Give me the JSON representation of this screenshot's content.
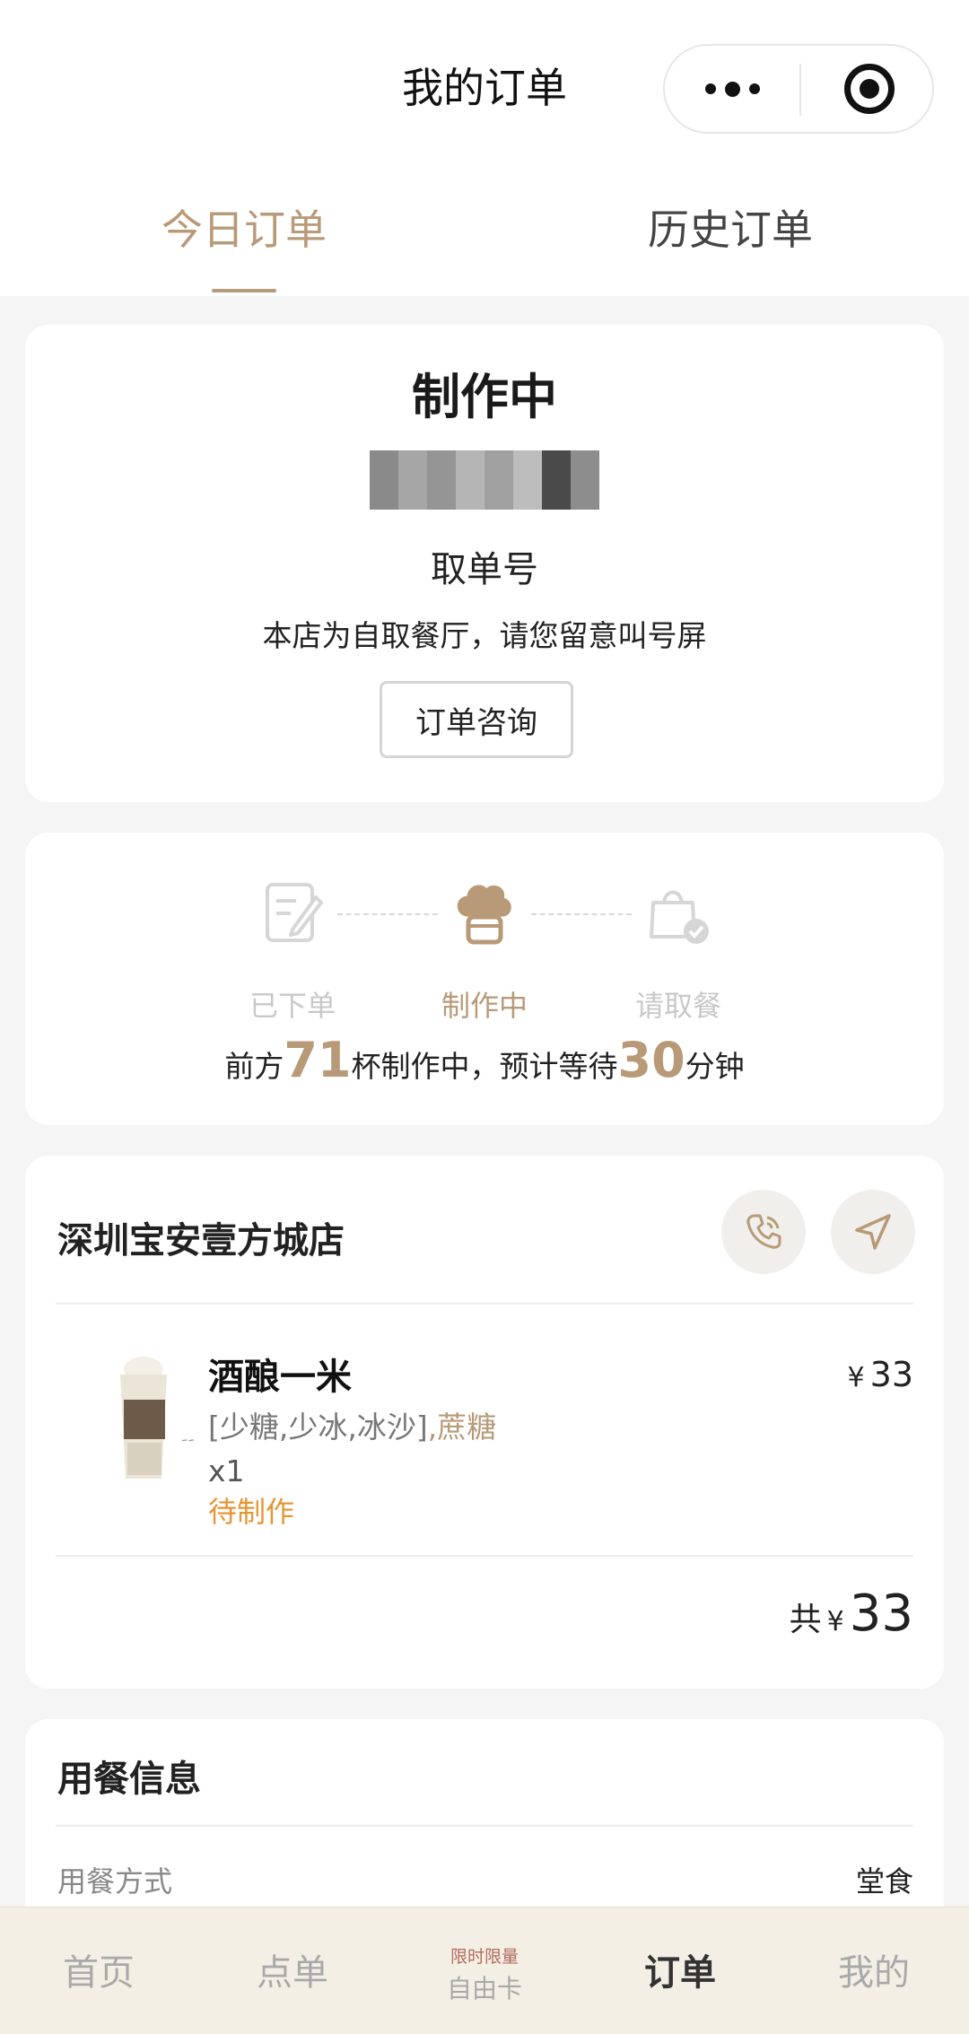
{
  "header": {
    "title": "我的订单",
    "tabs": [
      {
        "label": "今日订单",
        "active": true
      },
      {
        "label": "历史订单",
        "active": false
      }
    ]
  },
  "order_status": {
    "title": "制作中",
    "pickup_label": "取单号",
    "notice": "本店为自取餐厅，请您留意叫号屏",
    "consult_button": "订单咨询"
  },
  "progress": {
    "steps": [
      {
        "label": "已下单",
        "icon": "order-placed-icon"
      },
      {
        "label": "制作中",
        "icon": "chef-hat-icon"
      },
      {
        "label": "请取餐",
        "icon": "pickup-bag-icon"
      }
    ],
    "wait_prefix": "前方",
    "cups_ahead": "71",
    "wait_middle": "杯制作中，预计等待",
    "wait_minutes": "30",
    "wait_suffix": "分钟"
  },
  "store": {
    "name": "深圳宝安壹方城店",
    "item": {
      "name": "酒酿一米",
      "spec": "[少糖,少冰,冰沙]",
      "spec_extra": ",蔗糖",
      "quantity": "x1",
      "status": "待制作",
      "currency": "¥",
      "price": "33"
    },
    "total_label": "共",
    "total_currency": "¥",
    "total": "33"
  },
  "dining": {
    "title": "用餐信息",
    "rows": [
      {
        "label": "用餐方式",
        "value": "堂食"
      }
    ]
  },
  "tabbar": {
    "items": [
      {
        "label": "首页"
      },
      {
        "label": "点单"
      },
      {
        "tag": "限时限量",
        "label": "自由卡"
      },
      {
        "label": "订单",
        "active": true
      },
      {
        "label": "我的"
      }
    ]
  },
  "colors": {
    "accent": "#b89a78",
    "status_orange": "#e69534",
    "tabbar_bg": "#f4efe5"
  }
}
